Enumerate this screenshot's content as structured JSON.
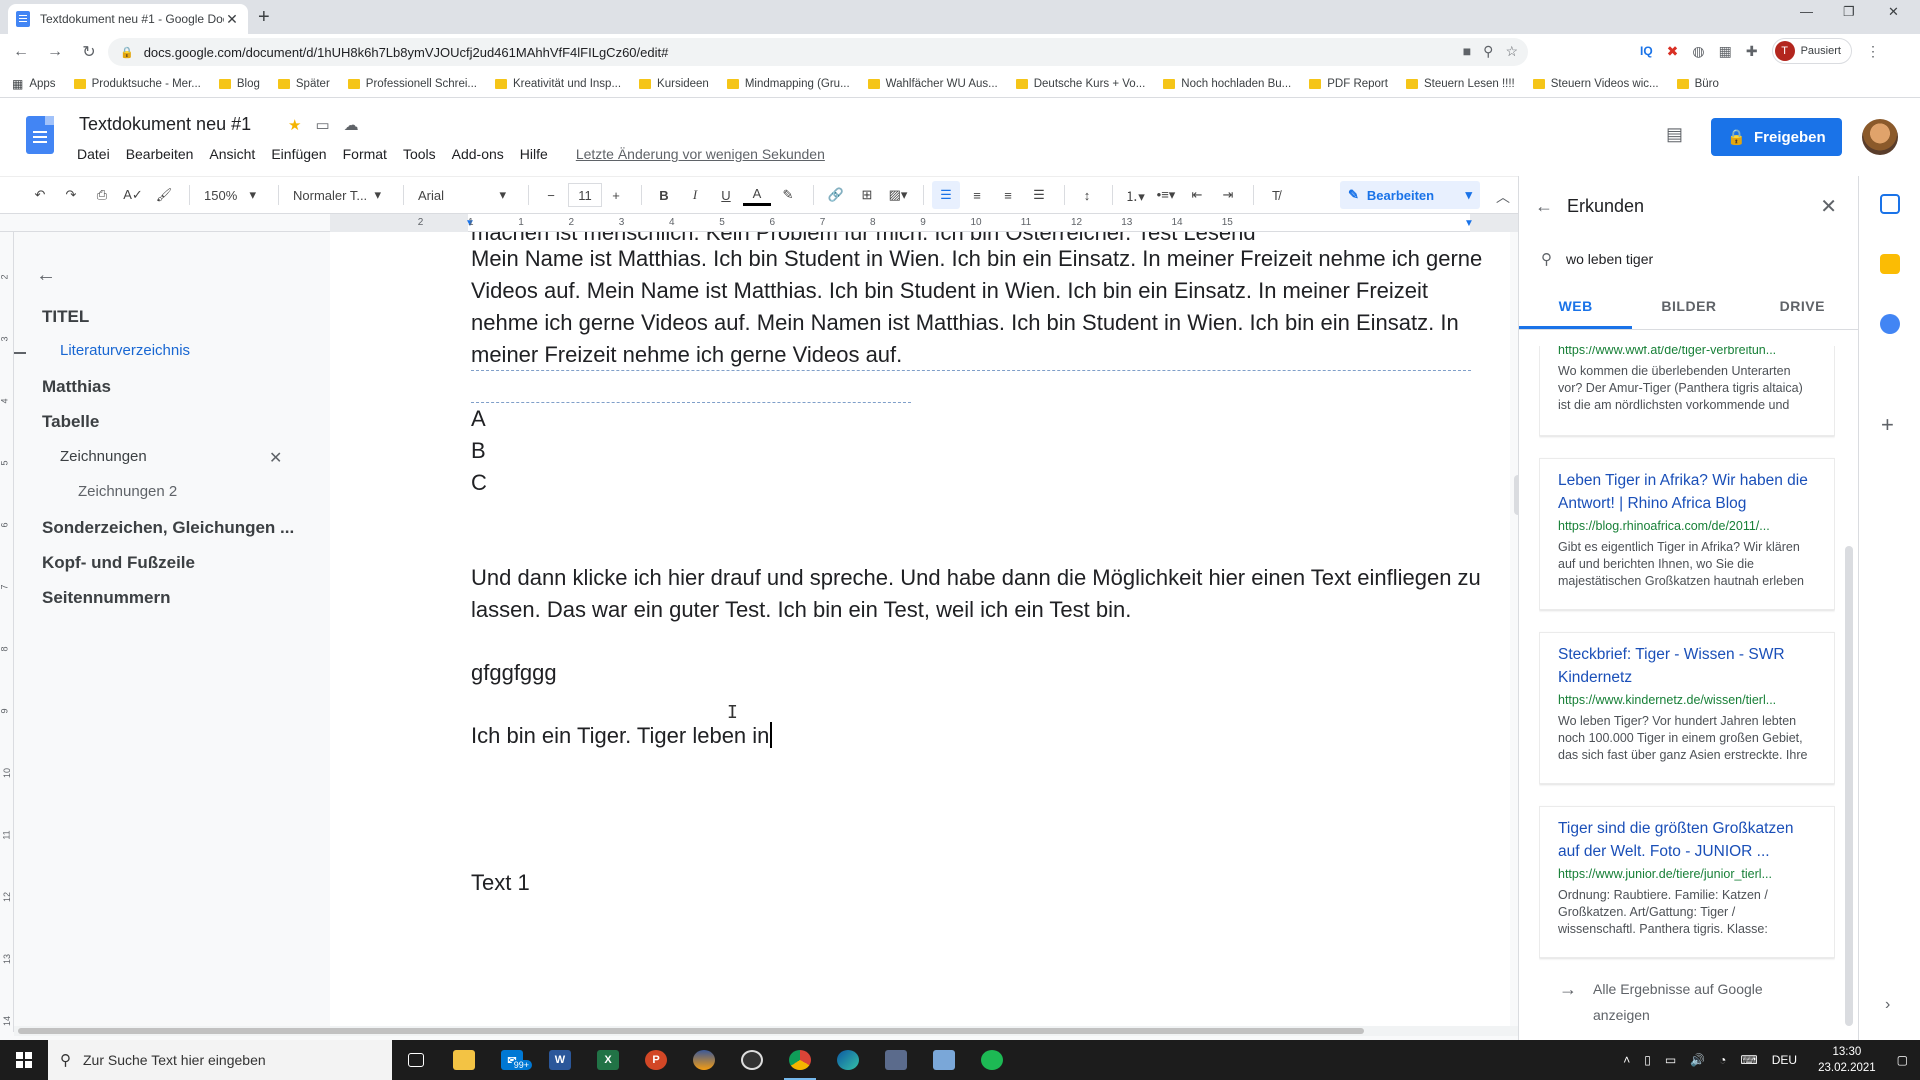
{
  "browser": {
    "tab_title": "Textdokument neu #1 - Google Docs",
    "url": "docs.google.com/document/d/1hUH8k6h7Lb8ymVJOUcfj2ud461MAhhVfF4lFILgCz60/edit#",
    "profile_initial": "T",
    "profile_status": "Pausiert",
    "bookmarks": [
      "Apps",
      "Produktsuche - Mer...",
      "Blog",
      "Später",
      "Professionell Schrei...",
      "Kreativität und Insp...",
      "Kursideen",
      "Mindmapping (Gru...",
      "Wahlfächer WU Aus...",
      "Deutsche Kurs + Vo...",
      "Noch hochladen Bu...",
      "PDF Report",
      "Steuern Lesen !!!!",
      "Steuern Videos wic...",
      "Büro"
    ]
  },
  "docs": {
    "title": "Textdokument neu #1",
    "menu": [
      "Datei",
      "Bearbeiten",
      "Ansicht",
      "Einfügen",
      "Format",
      "Tools",
      "Add-ons",
      "Hilfe"
    ],
    "last_edit": "Letzte Änderung vor wenigen Sekunden",
    "share_label": "Freigeben",
    "accent": "#1a73e8"
  },
  "toolbar": {
    "zoom": "150%",
    "style": "Normaler T...",
    "font": "Arial",
    "font_size": "11",
    "mode": "Bearbeiten"
  },
  "ruler": {
    "ticks": [
      "2",
      "1",
      "1",
      "2",
      "3",
      "4",
      "5",
      "6",
      "7",
      "8",
      "9",
      "10",
      "11",
      "12",
      "13",
      "14",
      "15"
    ]
  },
  "vruler": {
    "ticks": [
      "2",
      "3",
      "4",
      "5",
      "6",
      "7",
      "8",
      "9",
      "10",
      "11",
      "12",
      "13",
      "14"
    ]
  },
  "outline": {
    "items": [
      {
        "level": 1,
        "text": "TITEL"
      },
      {
        "level": 2,
        "text": "Literaturverzeichnis"
      },
      {
        "level": 1,
        "text": "Matthias"
      },
      {
        "level": 1,
        "text": "Tabelle"
      },
      {
        "level": 2,
        "text": "Zeichnungen"
      },
      {
        "level": 3,
        "text": "Zeichnungen 2"
      },
      {
        "level": 1,
        "text": "Sonderzeichen, Gleichungen ..."
      },
      {
        "level": 1,
        "text": "Kopf- und Fußzeile"
      },
      {
        "level": 1,
        "text": "Seitennummern"
      }
    ]
  },
  "document": {
    "cut_line": "machen ist menschlich. Kein Problem für mich. Ich bin Osterreicher. Test Lesend",
    "paragraph_1": "Mein Name ist Matthias. Ich bin Student in Wien. Ich bin ein Einsatz. In meiner Freizeit nehme ich gerne Videos auf. Mein Name ist Matthias. Ich bin Student in Wien. Ich bin ein Einsatz. In meiner Freizeit nehme ich gerne Videos auf. Mein Namen ist Matthias. Ich bin Student in Wien. Ich bin ein Einsatz. In meiner Freizeit nehme ich gerne Videos auf.",
    "list": [
      "A",
      "B",
      "C"
    ],
    "paragraph_2": "Und dann klicke ich hier drauf und spreche. Und habe dann die Möglichkeit hier einen Text einfliegen zu lassen. Das war ein guter Test. Ich bin ein Test, weil ich ein Test bin.",
    "paragraph_3": "gfggfggg",
    "paragraph_4": "Ich bin ein Tiger. Tiger leben in",
    "paragraph_5": "Text 1"
  },
  "explore": {
    "title": "Erkunden",
    "query": "wo leben tiger",
    "tabs": [
      "WEB",
      "BILDER",
      "DRIVE"
    ],
    "active_tab": "WEB",
    "results": [
      {
        "title": "",
        "url": "https://www.wwf.at/de/tiger-verbreitun...",
        "snippet": "Wo kommen die überlebenden Unterarten vor? Der Amur-Tiger (Panthera tigris altaica) ist die am nördlichsten vorkommende und größte"
      },
      {
        "title": "Leben Tiger in Afrika? Wir haben die Antwort! | Rhino Africa Blog",
        "url": "https://blog.rhinoafrica.com/de/2011/...",
        "snippet": "Gibt es eigentlich Tiger in Afrika? Wir klären auf und berichten Ihnen, wo Sie die majestätischen Großkatzen hautnah erleben"
      },
      {
        "title": "Steckbrief: Tiger - Wissen - SWR Kindernetz",
        "url": "https://www.kindernetz.de/wissen/tierl...",
        "snippet": "Wo leben Tiger? Vor hundert Jahren lebten noch 100.000 Tiger in einem großen Gebiet, das sich fast über ganz Asien erstreckte. Ihre Heimat"
      },
      {
        "title": "Tiger sind die größten Großkatzen auf der Welt. Foto - JUNIOR ...",
        "url": "https://www.junior.de/tiere/junior_tierl...",
        "snippet": "Ordnung: Raubtiere. Familie: Katzen / Großkatzen. Art/Gattung: Tiger / wissenschaftl. Panthera tigris. Klasse: Säugetiere. Lebensraum: Asien (Indien"
      }
    ],
    "all_results": "Alle Ergebnisse auf Google anzeigen"
  },
  "taskbar": {
    "search_placeholder": "Zur Suche Text hier eingeben",
    "mail_badge": "99+",
    "language": "DEU",
    "time": "13:30",
    "date": "23.02.2021"
  }
}
